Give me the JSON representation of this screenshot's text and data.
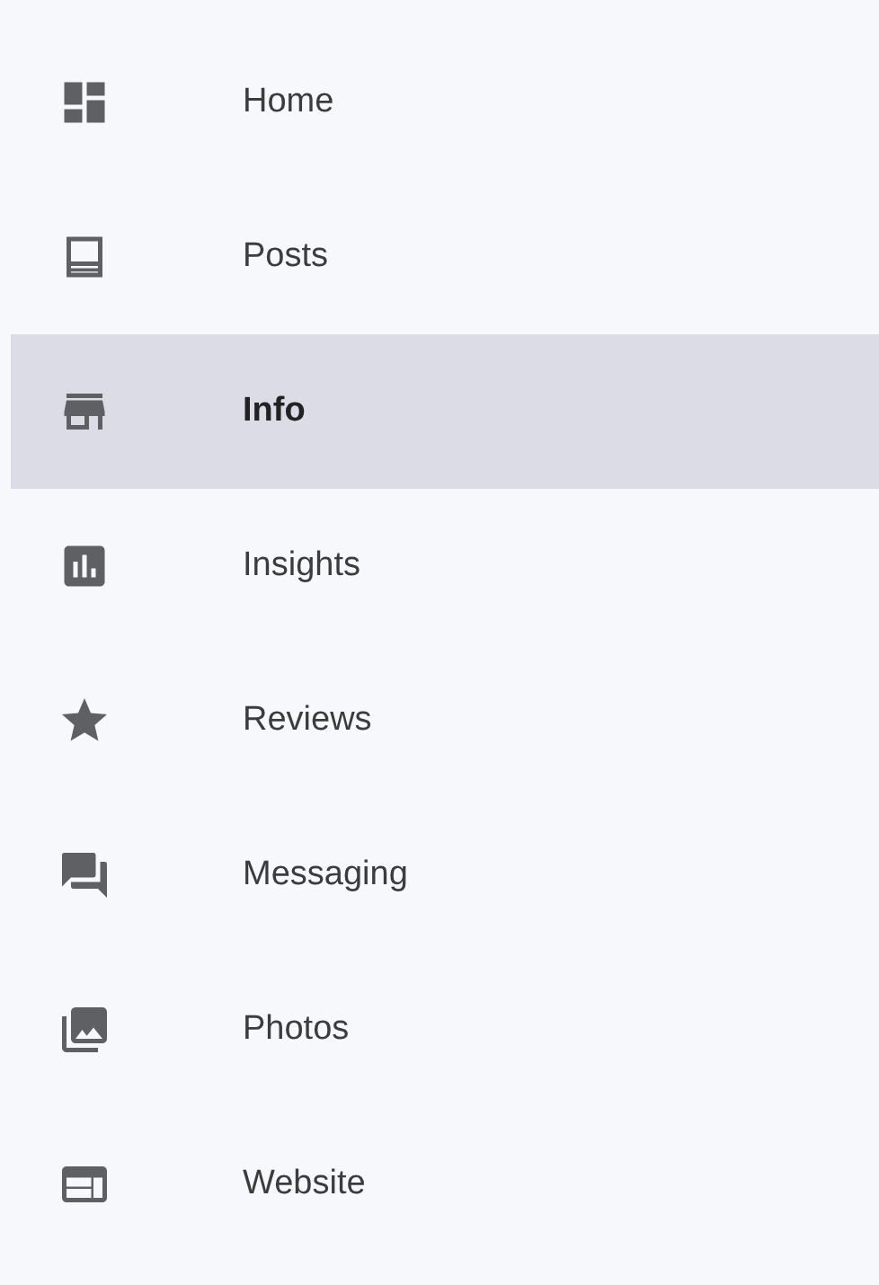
{
  "nav": {
    "items": [
      {
        "label": "Home",
        "kind": "dashboard",
        "selected": false
      },
      {
        "label": "Posts",
        "kind": "posts",
        "selected": false
      },
      {
        "label": "Info",
        "kind": "store",
        "selected": true
      },
      {
        "label": "Insights",
        "kind": "insights",
        "selected": false
      },
      {
        "label": "Reviews",
        "kind": "star",
        "selected": false
      },
      {
        "label": "Messaging",
        "kind": "chat",
        "selected": false
      },
      {
        "label": "Photos",
        "kind": "photos",
        "selected": false
      },
      {
        "label": "Website",
        "kind": "web",
        "selected": false
      }
    ]
  }
}
